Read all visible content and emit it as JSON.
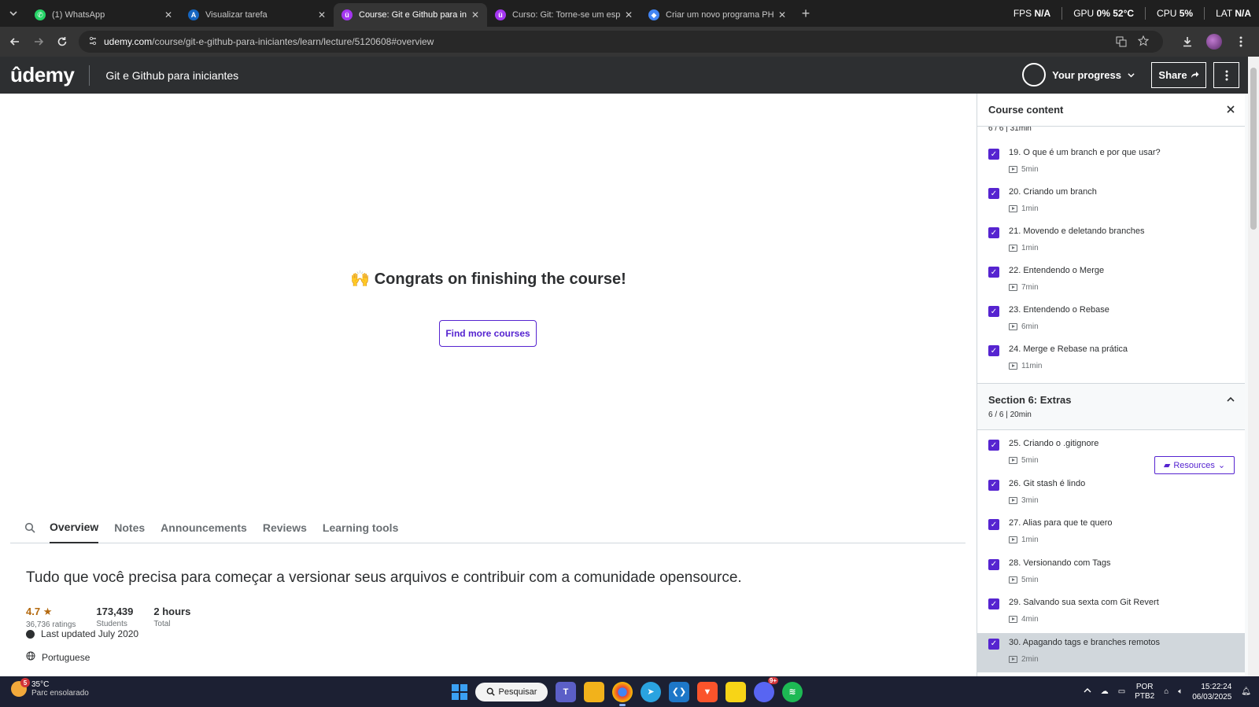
{
  "browser": {
    "tabs": [
      {
        "title": "(1) WhatsApp",
        "color": "#25d366",
        "glyph": "✆"
      },
      {
        "title": "Visualizar tarefa",
        "color": "#1565c0",
        "glyph": "A"
      },
      {
        "title": "Course: Git e Github para inicia",
        "color": "#a435f0",
        "glyph": "ü"
      },
      {
        "title": "Curso: Git: Torne-se um especia",
        "color": "#a435f0",
        "glyph": "ü"
      },
      {
        "title": "Criar um novo programa PHP -",
        "color": "#4285f4",
        "glyph": "◆"
      }
    ],
    "active_tab": 2,
    "new_tab": "+",
    "perf": {
      "fps_label": "FPS",
      "fps_value": "N/A",
      "gpu_label": "GPU",
      "gpu_value": "0%",
      "gpu_temp": "52°C",
      "cpu_label": "CPU",
      "cpu_value": "5%",
      "lat_label": "LAT",
      "lat_value": "N/A"
    },
    "url_domain": "udemy.com",
    "url_path": "/course/git-e-github-para-iniciantes/learn/lecture/5120608#overview"
  },
  "header": {
    "logo": "ûdemy",
    "course_title": "Git e Github para iniciantes",
    "progress_label": "Your progress",
    "share_label": "Share"
  },
  "main": {
    "congrats": "🙌 Congrats on finishing the course!",
    "find_more": "Find more courses",
    "tabs": [
      "Overview",
      "Notes",
      "Announcements",
      "Reviews",
      "Learning tools"
    ],
    "active_tab": 0,
    "headline": "Tudo que você precisa para começar a versionar seus arquivos e contribuir com a comunidade opensource.",
    "stats": {
      "rating_value": "4.7",
      "rating_label": "36,736 ratings",
      "students_value": "173,439",
      "students_label": "Students",
      "total_value": "2 hours",
      "total_label": "Total"
    },
    "last_updated": "Last updated July 2020",
    "language": "Portuguese"
  },
  "sidebar": {
    "title": "Course content",
    "prev_section_summary": "6 / 6 | 31min",
    "section5_items": [
      {
        "title": "19. O que é um branch e por que usar?",
        "duration": "5min"
      },
      {
        "title": "20. Criando um branch",
        "duration": "1min"
      },
      {
        "title": "21. Movendo e deletando branches",
        "duration": "1min"
      },
      {
        "title": "22. Entendendo o Merge",
        "duration": "7min"
      },
      {
        "title": "23. Entendendo o Rebase",
        "duration": "6min"
      },
      {
        "title": "24. Merge e Rebase na prática",
        "duration": "11min"
      }
    ],
    "section6": {
      "title": "Section 6: Extras",
      "summary": "6 / 6 | 20min"
    },
    "section6_items": [
      {
        "title": "25. Criando o .gitignore",
        "duration": "5min"
      },
      {
        "title": "26. Git stash é lindo",
        "duration": "3min"
      },
      {
        "title": "27. Alias para que te quero",
        "duration": "1min"
      },
      {
        "title": "28. Versionando com Tags",
        "duration": "5min"
      },
      {
        "title": "29. Salvando sua sexta com Git Revert",
        "duration": "4min"
      },
      {
        "title": "30. Apagando tags e branches remotos",
        "duration": "2min"
      }
    ],
    "resources_label": "Resources"
  },
  "taskbar": {
    "weather_badge": "5",
    "temp": "35°C",
    "condition": "Parc ensolarado",
    "search_label": "Pesquisar",
    "lang_top": "POR",
    "lang_bottom": "PTB2",
    "time": "15:22:24",
    "date": "06/03/2025",
    "discord_badge": "9+"
  }
}
